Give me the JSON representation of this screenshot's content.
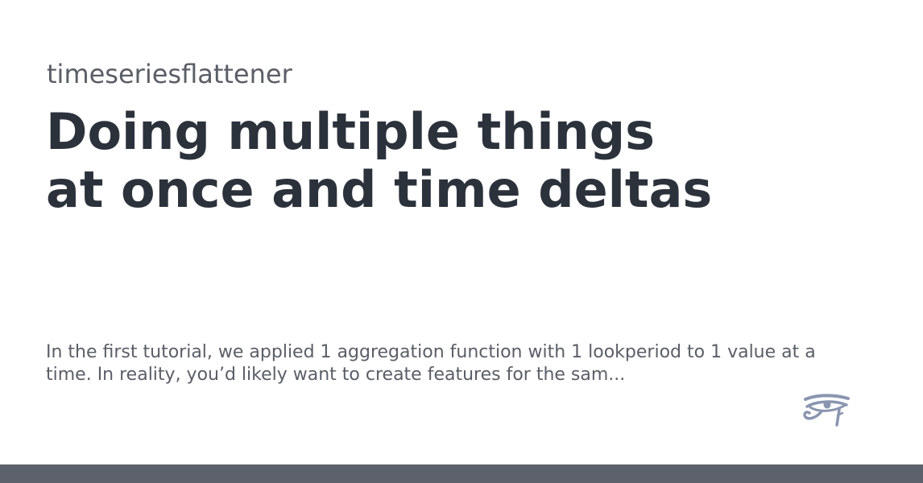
{
  "site": {
    "name": "timeseriesflattener"
  },
  "page": {
    "title": "Doing multiple things at once and time deltas",
    "description": "In the first tutorial, we applied 1 aggregation function with 1 lookperiod to 1 value at a time. In reality, you’d likely want to create features for the sam..."
  },
  "logo": {
    "icon": "eye-of-horus-icon",
    "color": "#8a96b0"
  },
  "colors": {
    "background": "#ffffff",
    "title": "#2c323b",
    "muted_text": "#5a5e66",
    "bottom_bar": "#5c616c"
  }
}
